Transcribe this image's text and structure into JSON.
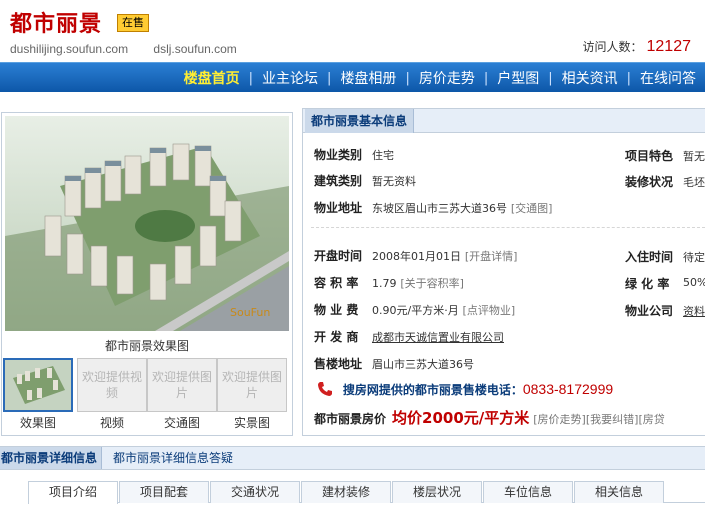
{
  "header": {
    "title": "都市丽景",
    "badge": "在售",
    "url1": "dushilijing.soufun.com",
    "url2": "dslj.soufun.com",
    "visits_label": "访问人数：",
    "visits_count": "12127"
  },
  "nav": {
    "items": [
      "楼盘首页",
      "业主论坛",
      "楼盘相册",
      "房价走势",
      "户型图",
      "相关资讯",
      "在线问答"
    ]
  },
  "gallery": {
    "main_caption": "都市丽景效果图",
    "watermark": "SouFun",
    "thumbs": [
      {
        "label": "",
        "caption": "效果图"
      },
      {
        "label": "欢迎提供视频",
        "caption": "视频"
      },
      {
        "label": "欢迎提供图片",
        "caption": "交通图"
      },
      {
        "label": "欢迎提供图片",
        "caption": "实景图"
      }
    ]
  },
  "info": {
    "title": "都市丽景基本信息",
    "type_label": "物业类别",
    "type_value": "住宅",
    "feature_label": "项目特色",
    "feature_value": "暂无",
    "arch_label": "建筑类别",
    "arch_value": "暂无资料",
    "decor_label": "装修状况",
    "decor_value": "毛坯",
    "addr_label": "物业地址",
    "addr_value": "东坡区眉山市三苏大道36号",
    "addr_link": "[交通图]",
    "open_label": "开盘时间",
    "open_value": "2008年01月01日",
    "open_link": "[开盘详情]",
    "move_label": "入住时间",
    "move_value": "待定",
    "far_label": "容 积 率",
    "far_value": "1.79",
    "far_link": "[关于容积率]",
    "green_label": "绿 化 率",
    "green_value": "50%",
    "fee_label": "物 业 费",
    "fee_value": "0.90元/平方米·月",
    "fee_link": "[点评物业]",
    "pm_label": "物业公司",
    "pm_value": "资料",
    "dev_label": "开 发 商",
    "dev_value": "成都市天诚信置业有限公司",
    "sales_label": "售楼地址",
    "sales_value": "眉山市三苏大道36号",
    "phone_label": "搜房网提供的都市丽景售楼电话：",
    "phone_value": "0833-8172999",
    "price_label": "都市丽景房价",
    "price_value": "均价2000元/平方米",
    "price_link1": "[房价走势]",
    "price_link2": "[我要纠错]",
    "price_link3": "[房贷"
  },
  "details": {
    "tab1": "都市丽景详细信息",
    "tab2": "都市丽景详细信息答疑",
    "subtabs": [
      "项目介绍",
      "项目配套",
      "交通状况",
      "建材装修",
      "楼层状况",
      "车位信息",
      "相关信息"
    ]
  },
  "colors": {
    "brand_red": "#c00000",
    "nav_blue": "#1466bc",
    "nav_active": "#ffee33"
  }
}
